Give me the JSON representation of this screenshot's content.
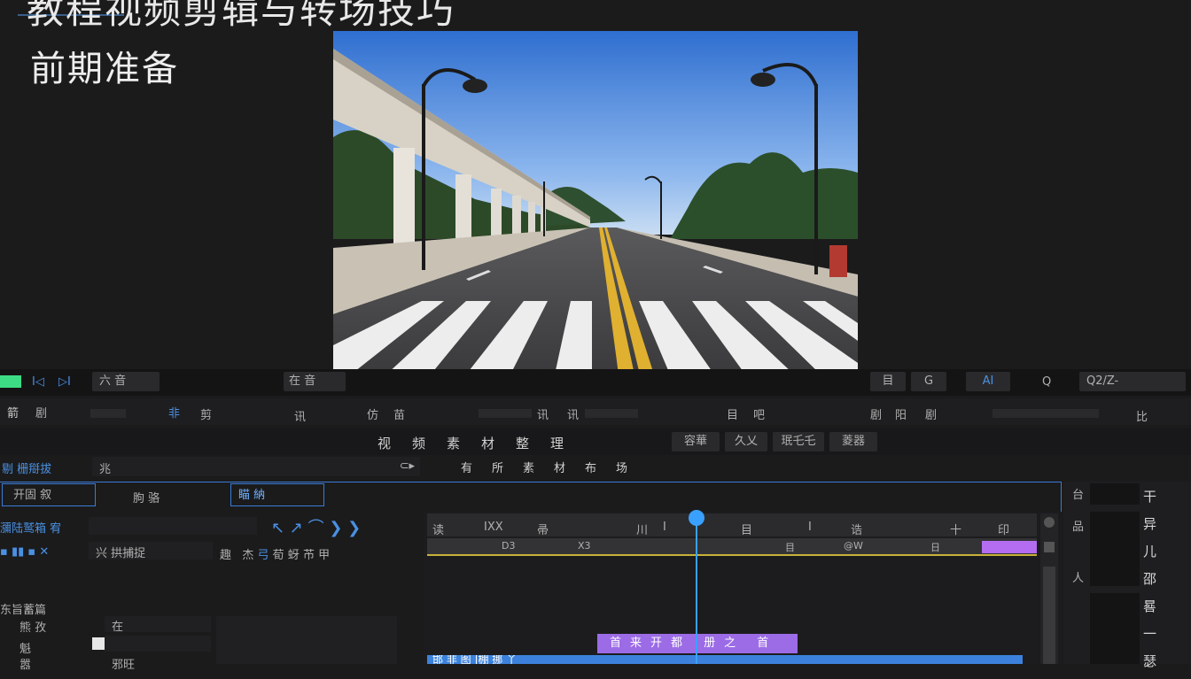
{
  "overlay": {
    "title": "教程视频剪辑与转场技巧",
    "subtitle": "前期准备"
  },
  "viewer_bar": {
    "left_tabs": [
      "I◁",
      "▷I"
    ],
    "left_label": "六 音",
    "center_label": "在 音",
    "right_buttons": [
      "目",
      "G",
      "AI",
      "Q"
    ],
    "zoom_text": "Q2/Z-"
  },
  "toolbar_row": {
    "items": [
      "箭",
      "剧",
      "非",
      "剪",
      "讯",
      "仿",
      "苗",
      "讯",
      "讯",
      "目",
      "吧",
      "剧",
      "阳",
      "剧",
      "比"
    ]
  },
  "section_header": {
    "title": "视频素材整理",
    "buttons": [
      "容華",
      "久乂",
      "珉乇乇",
      "菱器"
    ]
  },
  "project_panel": {
    "tab_label": "剔 栅搿拔",
    "search_value": "兆",
    "center_caption": "有所素材布场",
    "subtabs": [
      "开固 叙",
      "朐 骆",
      "瞄 納"
    ],
    "list_header": "瀰陆鹫箱 宥",
    "row_label": "兴 拱捕捉",
    "sequence_title": "东旨蓄篇",
    "tracks": [
      {
        "name": "熊 孜",
        "value": "在"
      },
      {
        "name": "魁",
        "value": ""
      },
      {
        "name": "嚣",
        "value": "邪旺"
      }
    ]
  },
  "timeline": {
    "ruler_labels": [
      "读",
      "IXX",
      "帚",
      "川",
      "I",
      "目",
      "I",
      "诰",
      "十",
      "印"
    ],
    "track_labels": [
      "D3",
      "X3",
      "目",
      "@W",
      "日"
    ],
    "purple_clip_label": "首来开都 册之 首",
    "blue_clip_label": "邯 非 图 |棚 挪 丫",
    "playhead_percent": 44
  },
  "right_sidebar": {
    "icons": [
      "台",
      "品",
      "人"
    ],
    "items": [
      "干",
      "异",
      "儿",
      "邵",
      "晷",
      "一",
      "瑟"
    ]
  },
  "colors": {
    "accent": "#4a90e2",
    "purple_clip": "#9c6be6",
    "blue_clip": "#3c82dc",
    "playhead": "#3aa0ff"
  }
}
